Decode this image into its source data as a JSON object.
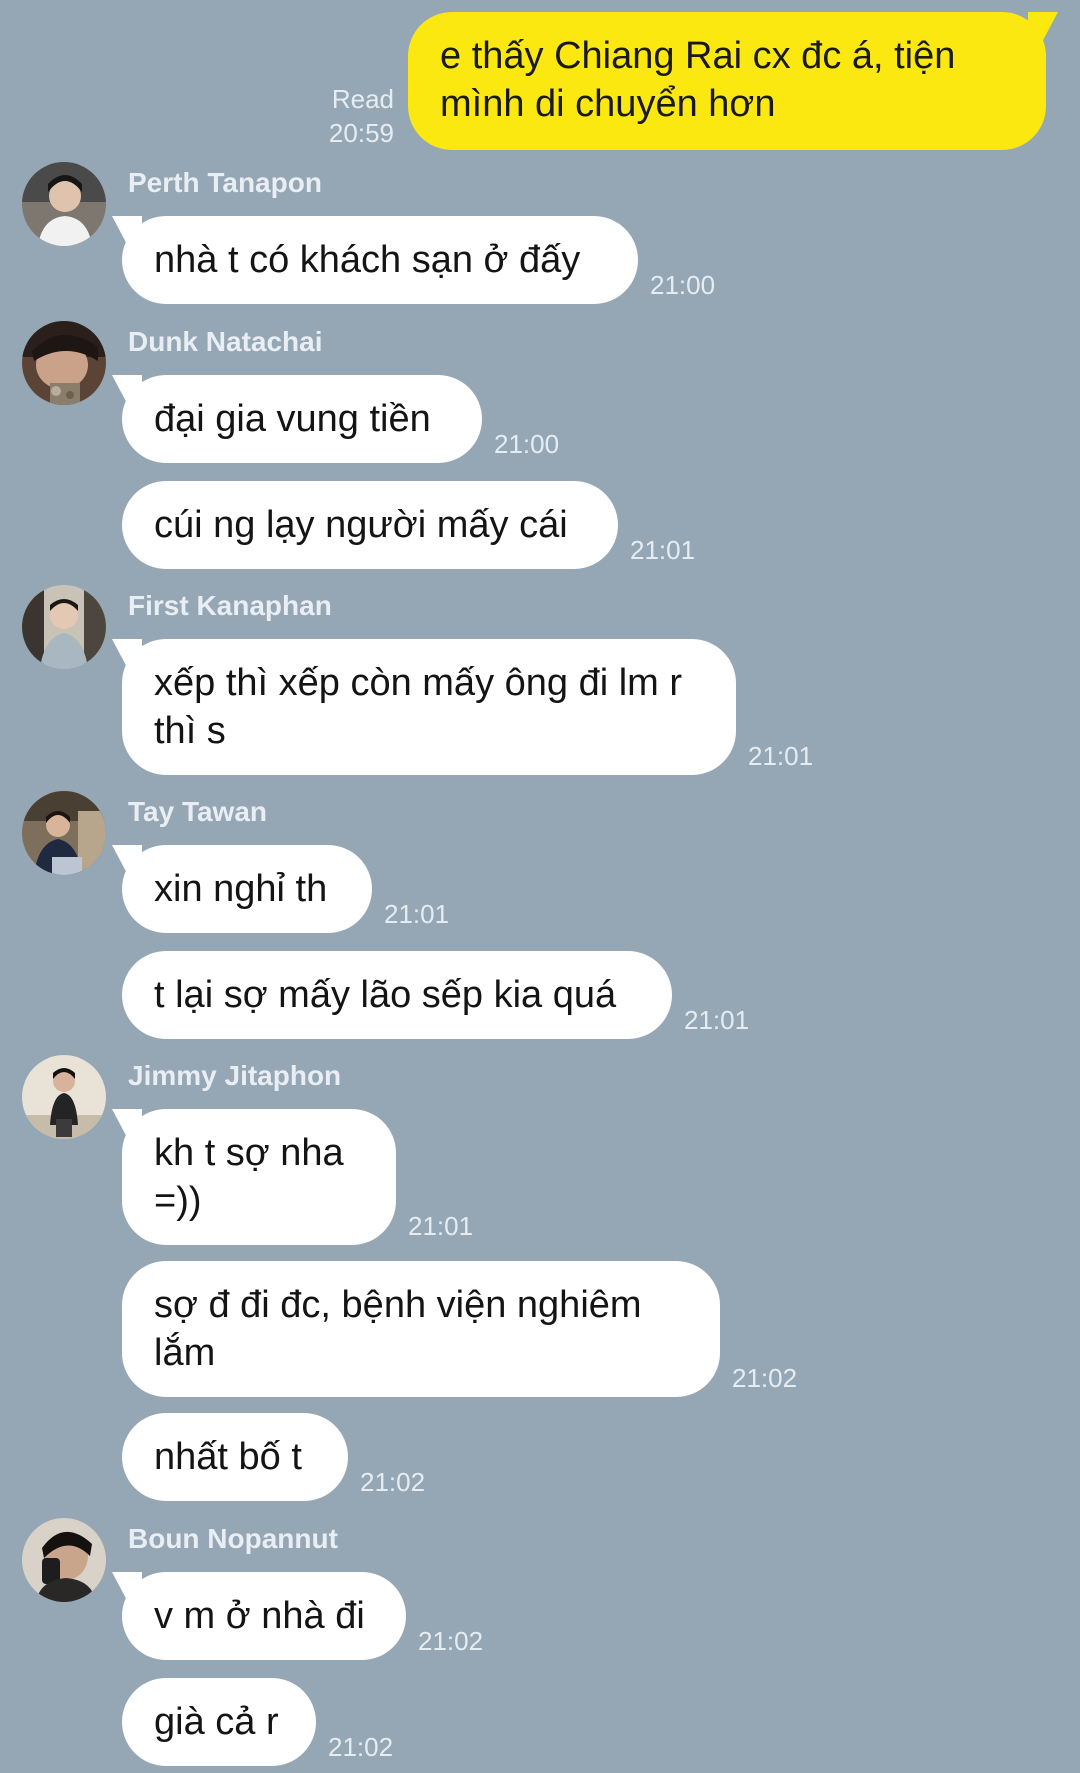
{
  "outgoing": {
    "read_label": "Read",
    "time": "20:59",
    "text": "e thấy Chiang Rai cx đc á, tiện mình di chuyển hơn"
  },
  "groups": [
    {
      "sender": "Perth Tanapon",
      "messages": [
        {
          "text": "nhà t có khách sạn ở đấy",
          "time": "21:00"
        }
      ]
    },
    {
      "sender": "Dunk Natachai",
      "messages": [
        {
          "text": "đại gia vung tiền",
          "time": "21:00"
        },
        {
          "text": "cúi ng lạy người mấy cái",
          "time": "21:01"
        }
      ]
    },
    {
      "sender": "First Kanaphan",
      "messages": [
        {
          "text": "xếp thì xếp còn mấy ông đi lm r thì s",
          "time": "21:01"
        }
      ]
    },
    {
      "sender": "Tay Tawan",
      "messages": [
        {
          "text": "xin nghỉ th",
          "time": "21:01"
        },
        {
          "text": "t lại sợ mấy lão sếp kia quá",
          "time": "21:01"
        }
      ]
    },
    {
      "sender": "Jimmy Jitaphon",
      "messages": [
        {
          "text": "kh t sợ nha =))",
          "time": "21:01"
        },
        {
          "text": "sợ đ đi đc, bệnh viện nghiêm lắm",
          "time": "21:02"
        },
        {
          "text": "nhất bố t",
          "time": "21:02"
        }
      ]
    },
    {
      "sender": "Boun Nopannut",
      "messages": [
        {
          "text": "v m ở nhà đi",
          "time": "21:02"
        },
        {
          "text": "già cả r",
          "time": "21:02"
        }
      ]
    }
  ]
}
